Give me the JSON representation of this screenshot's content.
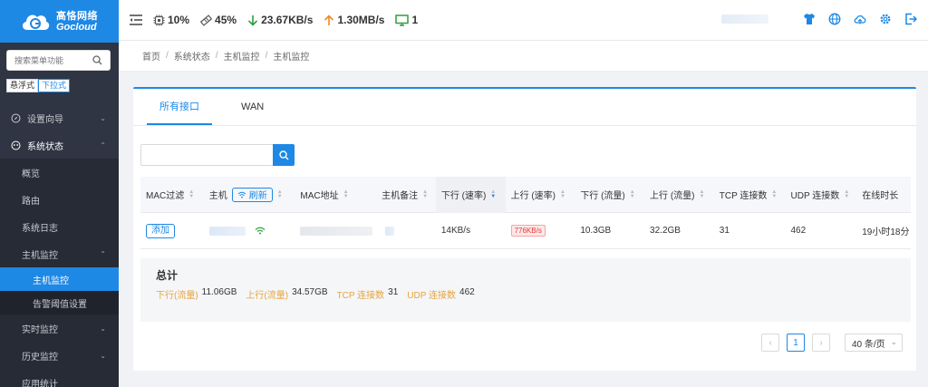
{
  "brand": {
    "name_cn": "高恪网络",
    "name_en": "Gocloud"
  },
  "topbar": {
    "cpu": "10%",
    "memory": "45%",
    "download_speed": "23.67KB/s",
    "upload_speed": "1.30MB/s",
    "online_hosts": "1"
  },
  "sidebar": {
    "search_placeholder": "搜索菜单功能",
    "modes": [
      "悬浮式",
      "下拉式"
    ],
    "menu": [
      {
        "label": "设置向导"
      },
      {
        "label": "系统状态"
      }
    ],
    "sub": {
      "overview": "概览",
      "route": "路由",
      "syslog": "系统日志",
      "host_monitor": "主机监控",
      "host_monitor_sub": "主机监控",
      "alert_threshold": "告警阈值设置",
      "realtime": "实时监控",
      "history": "历史监控",
      "partial": "应用统计"
    }
  },
  "breadcrumb": [
    "首页",
    "系统状态",
    "主机监控",
    "主机监控"
  ],
  "tabs": [
    "所有接口",
    "WAN"
  ],
  "table": {
    "columns": {
      "mac_filter": "MAC过滤",
      "host": "主机",
      "refresh": "刷新",
      "mac": "MAC地址",
      "note": "主机备注",
      "down_rate": "下行 (速率)",
      "up_rate": "上行 (速率)",
      "down_flow": "下行 (流量)",
      "up_flow": "上行 (流量)",
      "tcp": "TCP 连接数",
      "udp": "UDP 连接数",
      "online": "在线时长"
    },
    "row": {
      "add": "添加",
      "down_rate": "14KB/s",
      "up_rate": "776KB/s",
      "down_flow": "10.3GB",
      "up_flow": "32.2GB",
      "tcp": "31",
      "udp": "462",
      "online": "19小时18分"
    }
  },
  "summary": {
    "title": "总计",
    "down_label": "下行(流量)",
    "down_value": "11.06GB",
    "up_label": "上行(流量)",
    "up_value": "34.57GB",
    "tcp_label": "TCP 连接数",
    "tcp_value": "31",
    "udp_label": "UDP 连接数",
    "udp_value": "462"
  },
  "pager": {
    "current": "1",
    "page_size": "40 条/页"
  },
  "colors": {
    "accent": "#1e88e5",
    "sidebar": "#2f3542",
    "warn": "#e8a33d"
  }
}
